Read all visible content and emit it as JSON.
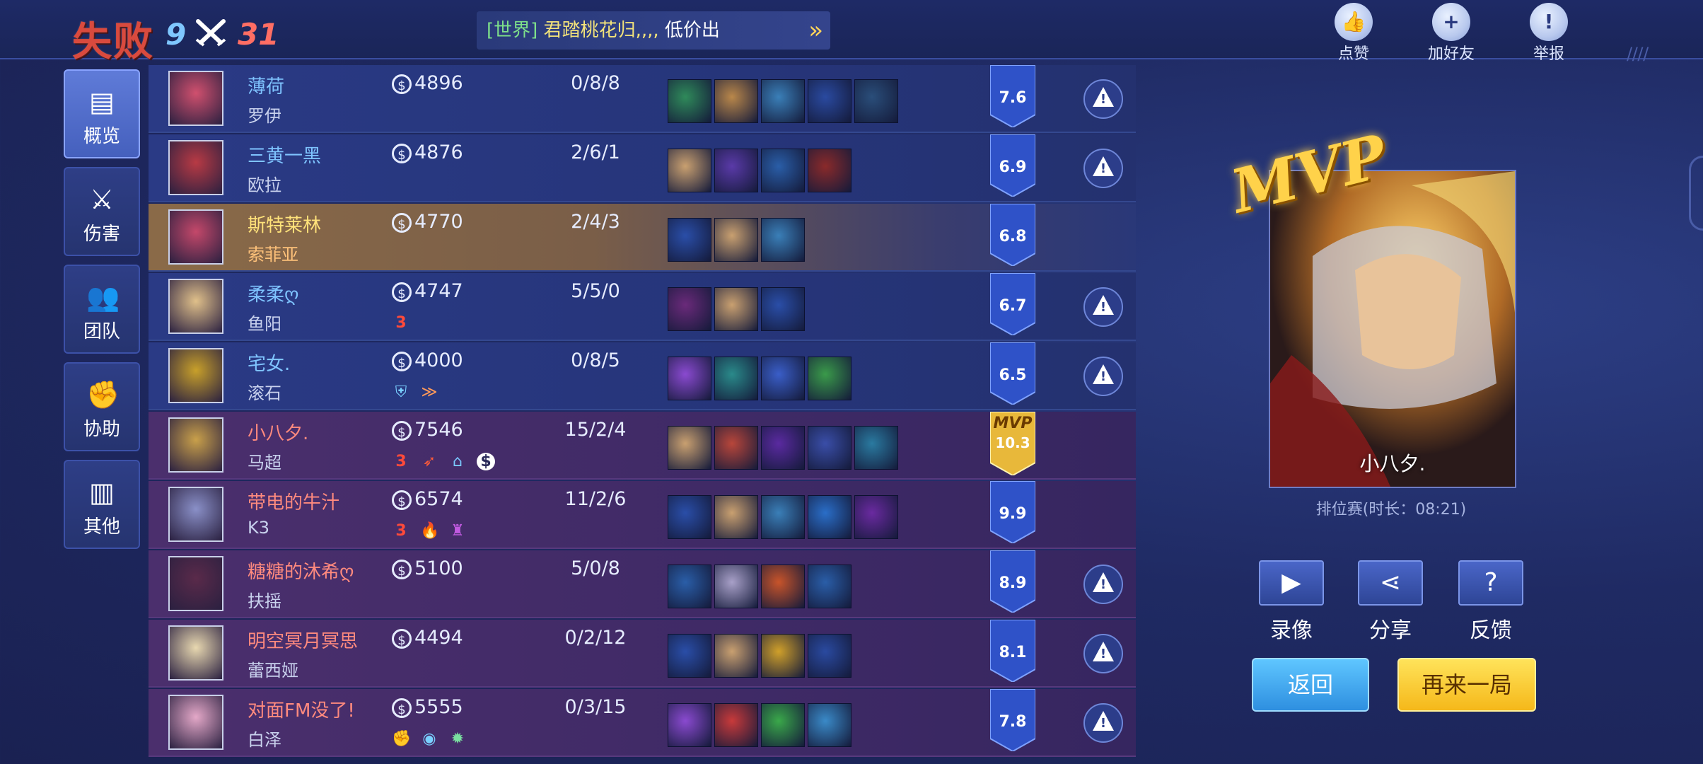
{
  "header": {
    "result": "失败",
    "team_kills": "9",
    "enemy_kills": "31",
    "ticker": {
      "channel": "[世界]",
      "player": "君踏桃花归,,,,",
      "message": "低价出"
    },
    "buttons": [
      {
        "label": "点赞",
        "icon": "thumbs-up-icon"
      },
      {
        "label": "加好友",
        "icon": "add-friend-icon"
      },
      {
        "label": "举报",
        "icon": "warning-icon"
      }
    ]
  },
  "nav": [
    {
      "label": "概览",
      "icon": "overview-icon",
      "active": true
    },
    {
      "label": "伤害",
      "icon": "sword-icon",
      "active": false
    },
    {
      "label": "团队",
      "icon": "team-icon",
      "active": false
    },
    {
      "label": "协助",
      "icon": "fist-icon",
      "active": false
    },
    {
      "label": "其他",
      "icon": "bar-chart-icon",
      "active": false
    }
  ],
  "players": [
    {
      "team": "blue",
      "name": "薄荷",
      "hero": "罗伊",
      "gold": "4896",
      "kda": "0/8/8",
      "badges": [],
      "score": "7.6",
      "report": true,
      "items": 5,
      "avatar_color": "#d0506e"
    },
    {
      "team": "blue",
      "name": "三黄一黑",
      "hero": "欧拉",
      "gold": "4876",
      "kda": "2/6/1",
      "badges": [],
      "score": "6.9",
      "report": true,
      "items": 4,
      "avatar_color": "#b83a44"
    },
    {
      "team": "self",
      "name": "斯特莱林",
      "hero": "索菲亚",
      "gold": "4770",
      "kda": "2/4/3",
      "badges": [],
      "score": "6.8",
      "report": false,
      "items": 3,
      "avatar_color": "#c4486a"
    },
    {
      "team": "blue",
      "name": "柔柔ღ",
      "hero": "鱼阳",
      "gold": "4747",
      "kda": "5/5/0",
      "badges": [
        "3"
      ],
      "score": "6.7",
      "report": true,
      "items": 3,
      "avatar_color": "#e0c08a"
    },
    {
      "team": "blue",
      "name": "宅女.",
      "hero": "滚石",
      "gold": "4000",
      "kda": "0/8/5",
      "badges": [
        "shield",
        "arrows"
      ],
      "score": "6.5",
      "report": true,
      "items": 4,
      "avatar_color": "#c8a02a"
    },
    {
      "team": "red",
      "name": "小八夕.",
      "hero": "马超",
      "gold": "7546",
      "kda": "15/2/4",
      "badges": [
        "3",
        "feather",
        "hood",
        "coin"
      ],
      "score": "10.3",
      "mvp": true,
      "report": false,
      "items": 5,
      "avatar_color": "#c9a04a"
    },
    {
      "team": "red",
      "name": "带电的牛汁",
      "hero": "K3",
      "gold": "6574",
      "kda": "11/2/6",
      "badges": [
        "3",
        "fire",
        "castle"
      ],
      "score": "9.9",
      "report": false,
      "items": 5,
      "avatar_color": "#8a90c8"
    },
    {
      "team": "red",
      "name": "糖糖的沐希ღ",
      "hero": "扶摇",
      "gold": "5100",
      "kda": "5/0/8",
      "badges": [],
      "score": "8.9",
      "report": true,
      "items": 4,
      "avatar_color": "#5a2a4a"
    },
    {
      "team": "red",
      "name": "明空冥月冥思",
      "hero": "蕾西娅",
      "gold": "4494",
      "kda": "0/2/12",
      "badges": [],
      "score": "8.1",
      "report": true,
      "items": 4,
      "avatar_color": "#e8d8b0"
    },
    {
      "team": "red",
      "name": "对面FM没了!",
      "hero": "白泽",
      "gold": "5555",
      "kda": "0/3/15",
      "badges": [
        "fist",
        "eye",
        "bomb"
      ],
      "score": "7.8",
      "report": true,
      "items": 4,
      "avatar_color": "#e4a8c8"
    }
  ],
  "mvp": {
    "logo": "MVP",
    "mvp_label": "MVP",
    "player": "小八夕.",
    "match_info": "排位赛(时长：08:21)"
  },
  "actions": [
    {
      "label": "录像",
      "icon": "video-camera-icon"
    },
    {
      "label": "分享",
      "icon": "share-icon"
    },
    {
      "label": "反馈",
      "icon": "feedback-document-icon"
    }
  ],
  "buttons": {
    "back": "返回",
    "again": "再来一局"
  },
  "colors": {
    "blue_team": "#7fc4ff",
    "red_team": "#ff8a7e",
    "self": "#ffe27a",
    "gold_accent": "#ffd24a"
  }
}
